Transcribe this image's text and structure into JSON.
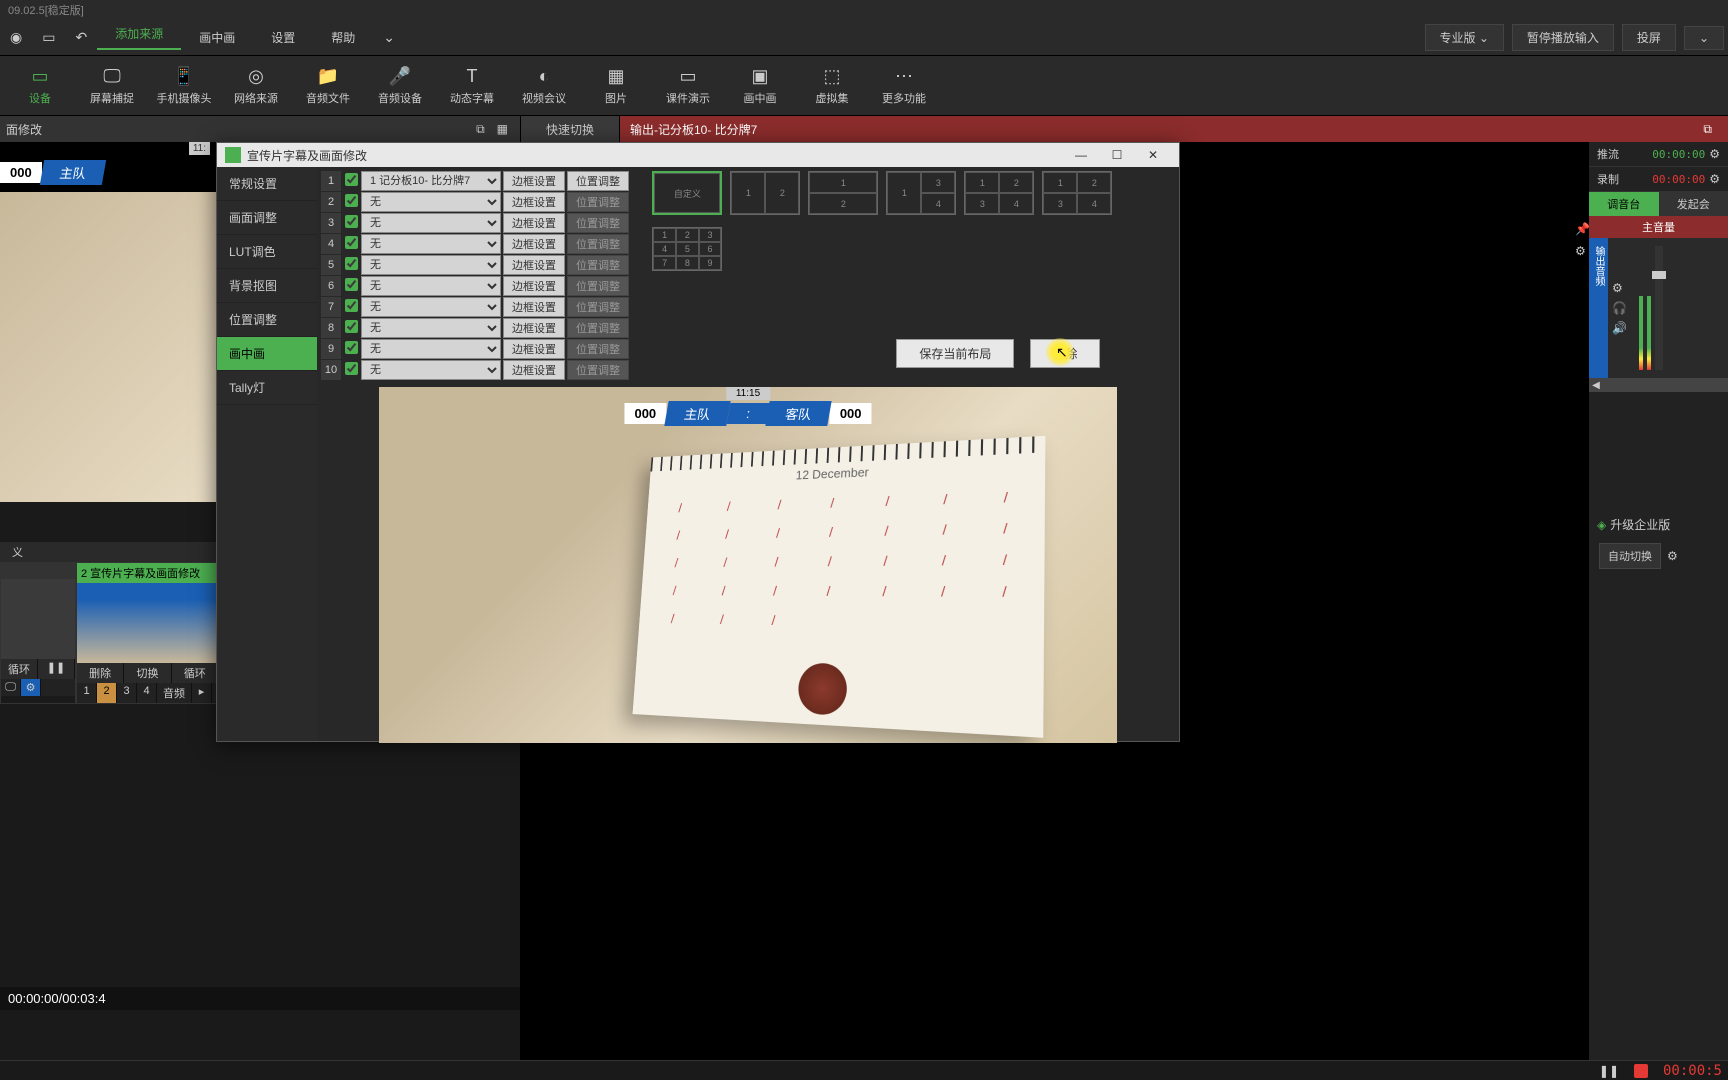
{
  "title_suffix": "09.02.5[稳定版]",
  "menu": {
    "icons": [
      "◉",
      "▭",
      "↶"
    ],
    "items": [
      "添加来源",
      "画中画",
      "设置",
      "帮助"
    ],
    "active": "添加来源",
    "caret": "⌄",
    "right": {
      "pro": "专业版",
      "pause_out": "暂停播放输入",
      "cast": "投屏"
    }
  },
  "toolbar": [
    {
      "label": "设备",
      "icon": "▭"
    },
    {
      "label": "屏幕捕捉",
      "icon": "🖵"
    },
    {
      "label": "手机摄像头",
      "icon": "📱"
    },
    {
      "label": "网络来源",
      "icon": "◎"
    },
    {
      "label": "音频文件",
      "icon": "📁"
    },
    {
      "label": "音频设备",
      "icon": "🎤"
    },
    {
      "label": "动态字幕",
      "icon": "T"
    },
    {
      "label": "视频会议",
      "icon": "◐"
    },
    {
      "label": "图片",
      "icon": "▦"
    },
    {
      "label": "课件演示",
      "icon": "▭"
    },
    {
      "label": "画中画",
      "icon": "▣"
    },
    {
      "label": "虚拟集",
      "icon": "⬚"
    },
    {
      "label": "更多功能",
      "icon": "⋯"
    }
  ],
  "header": {
    "left_tab": "面修改",
    "quick_switch": "快速切换",
    "output_label": "输出-记分板10- 比分牌7"
  },
  "scoreboard": {
    "time": "11:",
    "score_left": "000",
    "team_left": "主队"
  },
  "timeline": "00:00:00/00:03:4",
  "bottom": {
    "tabs": [
      "义"
    ],
    "sources": [
      {
        "name": "",
        "active": false
      },
      {
        "name": "2 宣传片字幕及画面修改",
        "active": true
      }
    ],
    "controls": [
      "删除",
      "切换",
      "循环"
    ],
    "left_ctrl": "循环",
    "nums": [
      "1",
      "2",
      "3",
      "4"
    ],
    "audio_btn": "音频"
  },
  "dialog": {
    "title": "宣传片字幕及画面修改",
    "sidebar": [
      "常规设置",
      "画面调整",
      "LUT调色",
      "背景抠图",
      "位置调整",
      "画中画",
      "Tally灯"
    ],
    "sidebar_active": "画中画",
    "rows": [
      {
        "n": "1",
        "sel": "1 记分板10- 比分牌7",
        "b1": "边框设置",
        "b2": "位置调整",
        "b2dis": false
      },
      {
        "n": "2",
        "sel": "无",
        "b1": "边框设置",
        "b2": "位置调整",
        "b2dis": true
      },
      {
        "n": "3",
        "sel": "无",
        "b1": "边框设置",
        "b2": "位置调整",
        "b2dis": true
      },
      {
        "n": "4",
        "sel": "无",
        "b1": "边框设置",
        "b2": "位置调整",
        "b2dis": true
      },
      {
        "n": "5",
        "sel": "无",
        "b1": "边框设置",
        "b2": "位置调整",
        "b2dis": true
      },
      {
        "n": "6",
        "sel": "无",
        "b1": "边框设置",
        "b2": "位置调整",
        "b2dis": true
      },
      {
        "n": "7",
        "sel": "无",
        "b1": "边框设置",
        "b2": "位置调整",
        "b2dis": true
      },
      {
        "n": "8",
        "sel": "无",
        "b1": "边框设置",
        "b2": "位置调整",
        "b2dis": true
      },
      {
        "n": "9",
        "sel": "无",
        "b1": "边框设置",
        "b2": "位置调整",
        "b2dis": true
      },
      {
        "n": "10",
        "sel": "无",
        "b1": "边框设置",
        "b2": "位置调整",
        "b2dis": true
      }
    ],
    "custom": "自定义",
    "save_btn": "保存当前布局",
    "delete_btn": "删除",
    "preview_sb": {
      "time": "11:15",
      "score_l": "000",
      "team_l": "主队",
      "colon": ":",
      "team_r": "客队",
      "score_r": "000"
    },
    "cal_month": "12 December"
  },
  "right": {
    "stream_lbl": "推流",
    "stream_time": "00:00:00",
    "rec_lbl": "录制",
    "rec_time": "00:00:00",
    "mixer_tab": "调音台",
    "call_tab": "发起会",
    "master_vol": "主音量",
    "out_audio": "输出音频",
    "upgrade": "升级企业版",
    "auto_switch": "自动切换"
  },
  "status": {
    "time": "00:00:5"
  }
}
